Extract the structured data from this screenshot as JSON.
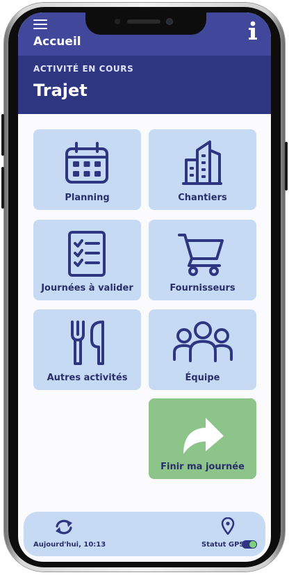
{
  "header": {
    "title": "Accueil",
    "menu_icon": "hamburger-menu-icon",
    "info_icon": "info-icon",
    "color": "#41489c"
  },
  "activity": {
    "label": "ACTIVITÉ EN COURS",
    "value": "Trajet",
    "color": "#2f3681"
  },
  "tiles": [
    {
      "label": "Planning",
      "icon": "calendar-icon"
    },
    {
      "label": "Chantiers",
      "icon": "buildings-icon"
    },
    {
      "label": "Journées à valider",
      "icon": "checklist-icon"
    },
    {
      "label": "Fournisseurs",
      "icon": "cart-icon"
    },
    {
      "label": "Autres activités",
      "icon": "fork-knife-icon"
    },
    {
      "label": "Équipe",
      "icon": "team-icon"
    },
    {
      "label": "Finir ma journée",
      "icon": "arrow-forward-icon"
    }
  ],
  "footer": {
    "sync_text": "Aujourd'hui, 10:13",
    "sync_icon": "sync-icon",
    "gps_text": "Statut GPS",
    "gps_icon": "location-pin-icon",
    "gps_enabled": true
  },
  "colors": {
    "tile": "#c6daf3",
    "tile_finish": "#8cc48a",
    "text": "#2a2f6c"
  }
}
